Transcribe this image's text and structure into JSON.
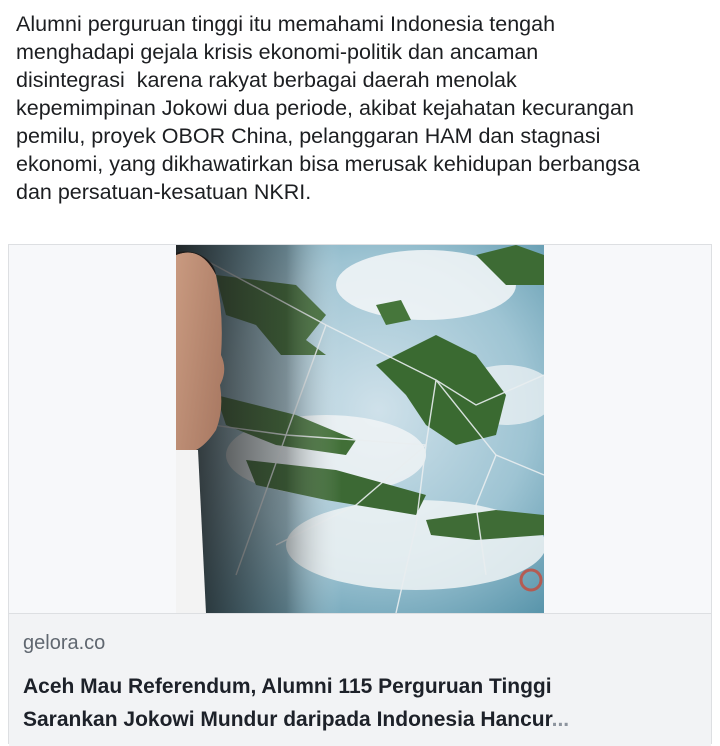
{
  "post": {
    "text_lines": [
      "Alumni perguruan tinggi itu memahami Indonesia tengah",
      "menghadapi gejala krisis ekonomi-politik dan ancaman",
      "disintegrasi  karena rakyat berbagai daerah menolak",
      "kepemimpinan Jokowi dua periode, akibat kejahatan kecurangan",
      "pemilu, proyek OBOR China, pelanggaran HAM dan stagnasi",
      "ekonomi, yang dikhawatirkan bisa merusak kehidupan berbangsa",
      "dan persatuan-kesatuan NKRI."
    ]
  },
  "link_card": {
    "domain": "gelora.co",
    "title_lines": [
      "Aceh Mau Referendum, Alumni 115 Perguruan Tinggi",
      "Sarankan Jokowi Mundur daripada Indonesia Hancur"
    ],
    "title_ellipsis": "..."
  },
  "colors": {
    "text": "#1c1e21",
    "domain": "#606770",
    "card_bg": "#f2f3f5",
    "card_border": "#dddfe2"
  }
}
